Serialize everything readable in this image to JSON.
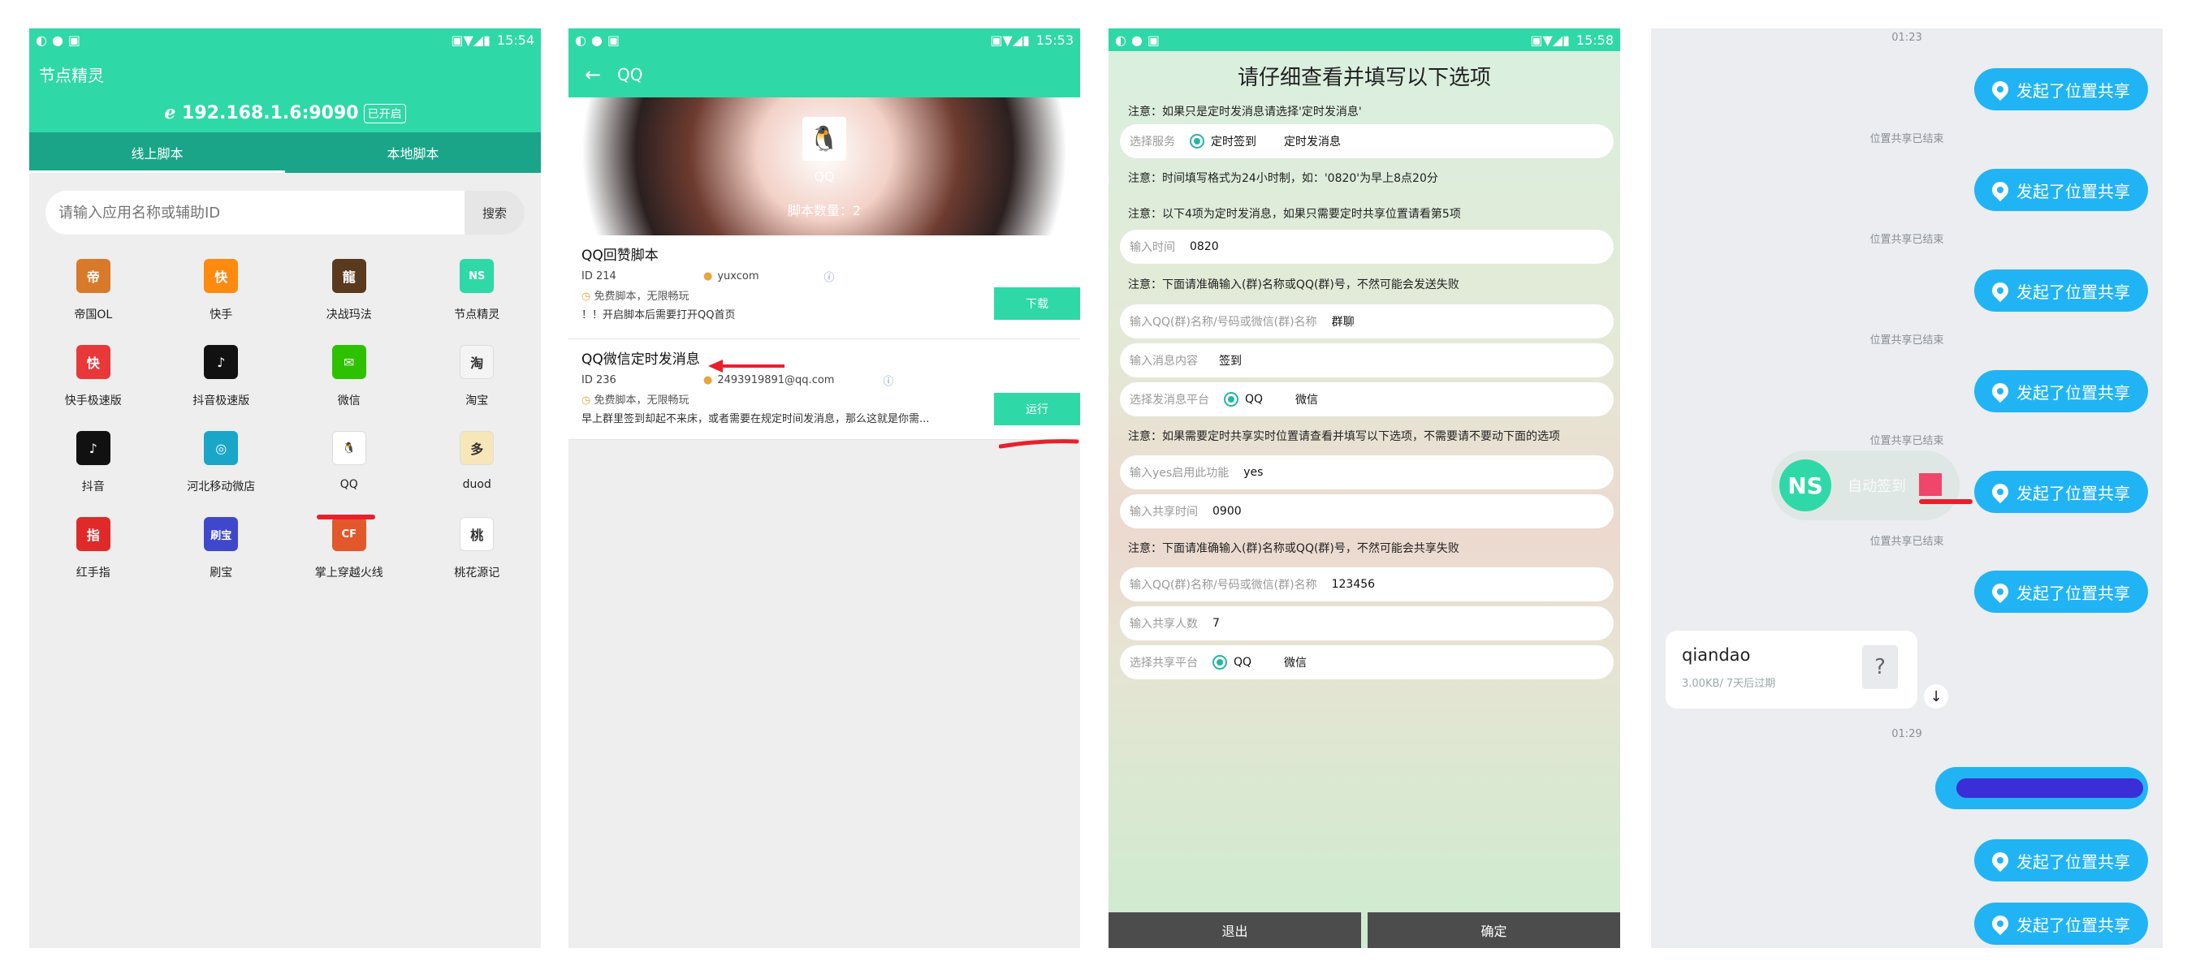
{
  "status_bars": {
    "s1": {
      "time": "15:54"
    },
    "s2": {
      "time": "15:53"
    },
    "s3": {
      "time": "15:58"
    }
  },
  "screen1": {
    "app_title": "节点精灵",
    "ip": "192.168.1.6:9090",
    "ip_badge": "已开启",
    "tabs": [
      "线上脚本",
      "本地脚本"
    ],
    "search": {
      "placeholder": "请输入应用名称或辅助ID",
      "button": "搜索"
    },
    "apps": [
      {
        "name": "帝国OL",
        "icon": "empire-ol-icon",
        "color": "#d9792a",
        "glyph": "帝"
      },
      {
        "name": "快手",
        "icon": "kuaishou-icon",
        "color": "#ff8a10",
        "glyph": "快"
      },
      {
        "name": "决战玛法",
        "icon": "juezhan-mafa-icon",
        "color": "#5a3a1e",
        "glyph": "龍"
      },
      {
        "name": "节点精灵",
        "icon": "nodejs-spirit-icon",
        "color": "#2fd8a7",
        "glyph": "NS"
      },
      {
        "name": "快手极速版",
        "icon": "kuaishou-lite-icon",
        "color": "#e8383a",
        "glyph": "快"
      },
      {
        "name": "抖音极速版",
        "icon": "douyin-lite-icon",
        "color": "#111111",
        "glyph": "♪"
      },
      {
        "name": "微信",
        "icon": "wechat-icon",
        "color": "#2dc100",
        "glyph": "✉"
      },
      {
        "name": "淘宝",
        "icon": "taobao-icon",
        "color": "#f4f4f4",
        "glyph": "淘"
      },
      {
        "name": "抖音",
        "icon": "douyin-icon",
        "color": "#111111",
        "glyph": "♪"
      },
      {
        "name": "河北移动微店",
        "icon": "hebei-mobile-icon",
        "color": "#1aa6c9",
        "glyph": "◎"
      },
      {
        "name": "QQ",
        "icon": "qq-penguin-icon",
        "color": "#ffffff",
        "glyph": "🐧"
      },
      {
        "name": "duod",
        "icon": "duod-icon",
        "color": "#f7e6b8",
        "glyph": "多"
      },
      {
        "name": "红手指",
        "icon": "redfinger-icon",
        "color": "#e02a2a",
        "glyph": "指"
      },
      {
        "name": "刷宝",
        "icon": "shuabao-icon",
        "color": "#3f48cc",
        "glyph": "刷宝"
      },
      {
        "name": "掌上穿越火线",
        "icon": "cf-mobile-icon",
        "color": "#e2582a",
        "glyph": "CF"
      },
      {
        "name": "桃花源记",
        "icon": "taohuayuan-icon",
        "color": "#ffffff",
        "glyph": "桃"
      }
    ]
  },
  "screen2": {
    "title": "QQ",
    "hero_name": "QQ",
    "hero_count": "脚本数量：2",
    "scripts": [
      {
        "title": "QQ回赞脚本",
        "id_label": "ID",
        "id": "214",
        "author": "yuxcom",
        "free": "免费脚本，无限畅玩",
        "desc": "！！开启脚本后需要打开QQ首页",
        "button": "下载"
      },
      {
        "title": "QQ微信定时发消息",
        "id_label": "ID",
        "id": "236",
        "author": "2493919891@qq.com",
        "free": "免费脚本，无限畅玩",
        "desc": "早上群里签到却起不来床，或者需要在规定时间发消息，那么这就是你需...",
        "button": "运行"
      }
    ]
  },
  "screen3": {
    "title": "请仔细查看并填写以下选项",
    "note1": "注意：如果只是定时发消息请选择'定时发消息'",
    "service_label": "选择服务",
    "service_options": [
      "定时签到",
      "定时发消息"
    ],
    "note2": "注意：时间填写格式为24小时制，如：'0820'为早上8点20分",
    "note3": "注意：以下4项为定时发消息，如果只需要定时共享位置请看第5项",
    "time_label": "输入时间",
    "time_value": "0820",
    "note4": "注意：下面请准确输入(群)名称或QQ(群)号，不然可能会发送失败",
    "target_label": "输入QQ(群)名称/号码或微信(群)名称",
    "target_value": "群聊",
    "msg_label": "输入消息内容",
    "msg_value": "签到",
    "platform_label": "选择发消息平台",
    "platform_options": [
      "QQ",
      "微信"
    ],
    "note5": "注意：如果需要定时共享实时位置请查看并填写以下选项，不需要请不要动下面的选项",
    "enable_label": "输入yes启用此功能",
    "enable_value": "yes",
    "share_time_label": "输入共享时间",
    "share_time_value": "0900",
    "note6": "注意：下面请准确输入(群)名称或QQ(群)号，不然可能会共享失败",
    "share_target_label": "输入QQ(群)名称/号码或微信(群)名称",
    "share_target_value": "123456",
    "share_count_label": "输入共享人数",
    "share_count_value": "7",
    "share_platform_label": "选择共享平台",
    "share_platform_options": [
      "QQ",
      "微信"
    ],
    "exit_button": "退出",
    "confirm_button": "确定"
  },
  "screen4": {
    "time1": "01:23",
    "location_msg": "发起了位置共享",
    "ended": "位置共享已结束",
    "float_text": "自动签到",
    "file_name": "qiandao",
    "file_info": "3.00KB/ 7天后过期",
    "file_badge": "?",
    "time2": "01:29"
  }
}
